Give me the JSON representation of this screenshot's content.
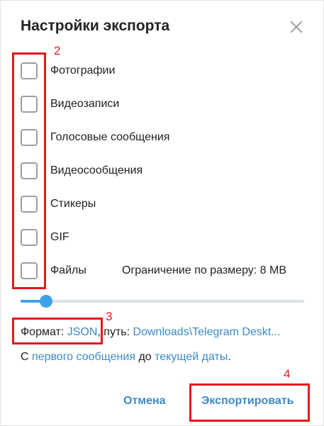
{
  "dialog": {
    "title": "Настройки экспорта"
  },
  "options": [
    {
      "label": "Фотографии",
      "checked": false
    },
    {
      "label": "Видеозаписи",
      "checked": false
    },
    {
      "label": "Голосовые сообщения",
      "checked": false
    },
    {
      "label": "Видеосообщения",
      "checked": false
    },
    {
      "label": "Стикеры",
      "checked": false
    },
    {
      "label": "GIF",
      "checked": false
    },
    {
      "label": "Файлы",
      "checked": false
    }
  ],
  "size_limit": {
    "text": "Ограничение по размеру: 8 MB",
    "slider_fraction": 0.09
  },
  "format": {
    "label": "Формат:",
    "value": "JSON",
    "path_label": ", путь:",
    "path_value": "Downloads\\Telegram Deskt..."
  },
  "range": {
    "from_prefix": "С",
    "from_value": "первого сообщения",
    "to_prefix": "до",
    "to_value": "текущей даты",
    "suffix": "."
  },
  "buttons": {
    "cancel": "Отмена",
    "export": "Экспортировать"
  },
  "annotations": {
    "n2": "2",
    "n3": "3",
    "n4": "4"
  },
  "colors": {
    "accent": "#3fa2e8",
    "link": "#3a8bc6",
    "annotation": "#e3191b"
  }
}
